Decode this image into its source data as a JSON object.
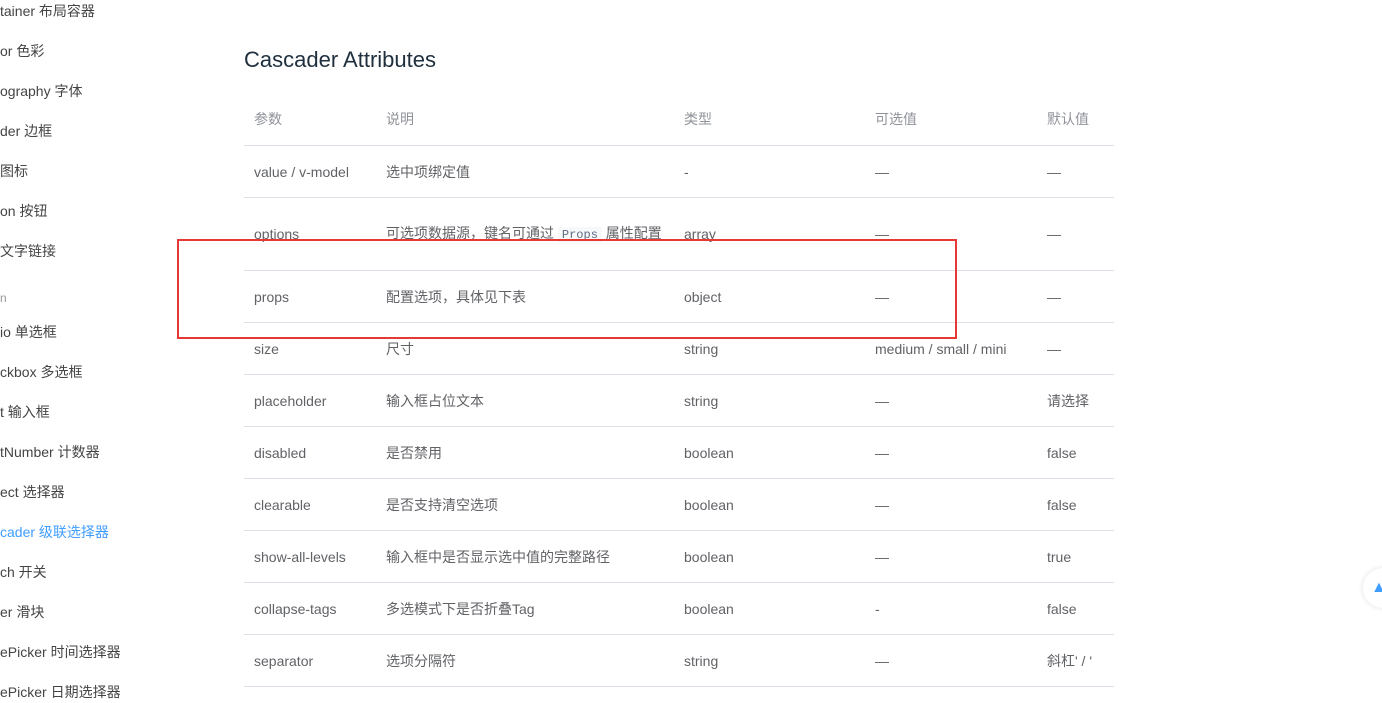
{
  "sidebar": {
    "items": [
      {
        "label": "tainer 布局容器"
      },
      {
        "label": "or 色彩"
      },
      {
        "label": "ography 字体"
      },
      {
        "label": "der 边框"
      },
      {
        "label": " 图标"
      },
      {
        "label": "on 按钮"
      },
      {
        "label": " 文字链接"
      },
      {
        "label": "io 单选框"
      },
      {
        "label": "ckbox 多选框"
      },
      {
        "label": "t 输入框"
      },
      {
        "label": "tNumber 计数器"
      },
      {
        "label": "ect 选择器"
      },
      {
        "label": "cader 级联选择器"
      },
      {
        "label": "ch 开关"
      },
      {
        "label": "er 滑块"
      },
      {
        "label": "ePicker 时间选择器"
      },
      {
        "label": "ePicker 日期选择器"
      }
    ],
    "group_label": "n"
  },
  "main": {
    "title": "Cascader Attributes",
    "columns": [
      "参数",
      "说明",
      "类型",
      "可选值",
      "默认值"
    ],
    "rows": [
      {
        "param": "value / v-model",
        "desc": "选中项绑定值",
        "type": "-",
        "options": "—",
        "default": "—"
      },
      {
        "param": "options",
        "desc_before": "可选项数据源，键名可通过",
        "desc_code": "Props",
        "desc_after": "属性配置",
        "type": "array",
        "options": "—",
        "default": "—"
      },
      {
        "param": "props",
        "desc": "配置选项，具体见下表",
        "type": "object",
        "options": "—",
        "default": "—"
      },
      {
        "param": "size",
        "desc": "尺寸",
        "type": "string",
        "options": "medium / small / mini",
        "default": "—"
      },
      {
        "param": "placeholder",
        "desc": "输入框占位文本",
        "type": "string",
        "options": "—",
        "default": "请选择"
      },
      {
        "param": "disabled",
        "desc": "是否禁用",
        "type": "boolean",
        "options": "—",
        "default": "false"
      },
      {
        "param": "clearable",
        "desc": "是否支持清空选项",
        "type": "boolean",
        "options": "—",
        "default": "false"
      },
      {
        "param": "show-all-levels",
        "desc": "输入框中是否显示选中值的完整路径",
        "type": "boolean",
        "options": "—",
        "default": "true"
      },
      {
        "param": "collapse-tags",
        "desc": "多选模式下是否折叠Tag",
        "type": "boolean",
        "options": "-",
        "default": "false"
      },
      {
        "param": "separator",
        "desc": "选项分隔符",
        "type": "string",
        "options": "—",
        "default": "斜杠' / '"
      }
    ]
  },
  "scroll_top": {
    "icon": "chevron-up-icon",
    "glyph": "▲"
  },
  "colors": {
    "accent": "#409eff",
    "highlight": "#e53935",
    "border": "#dcdfe6"
  }
}
